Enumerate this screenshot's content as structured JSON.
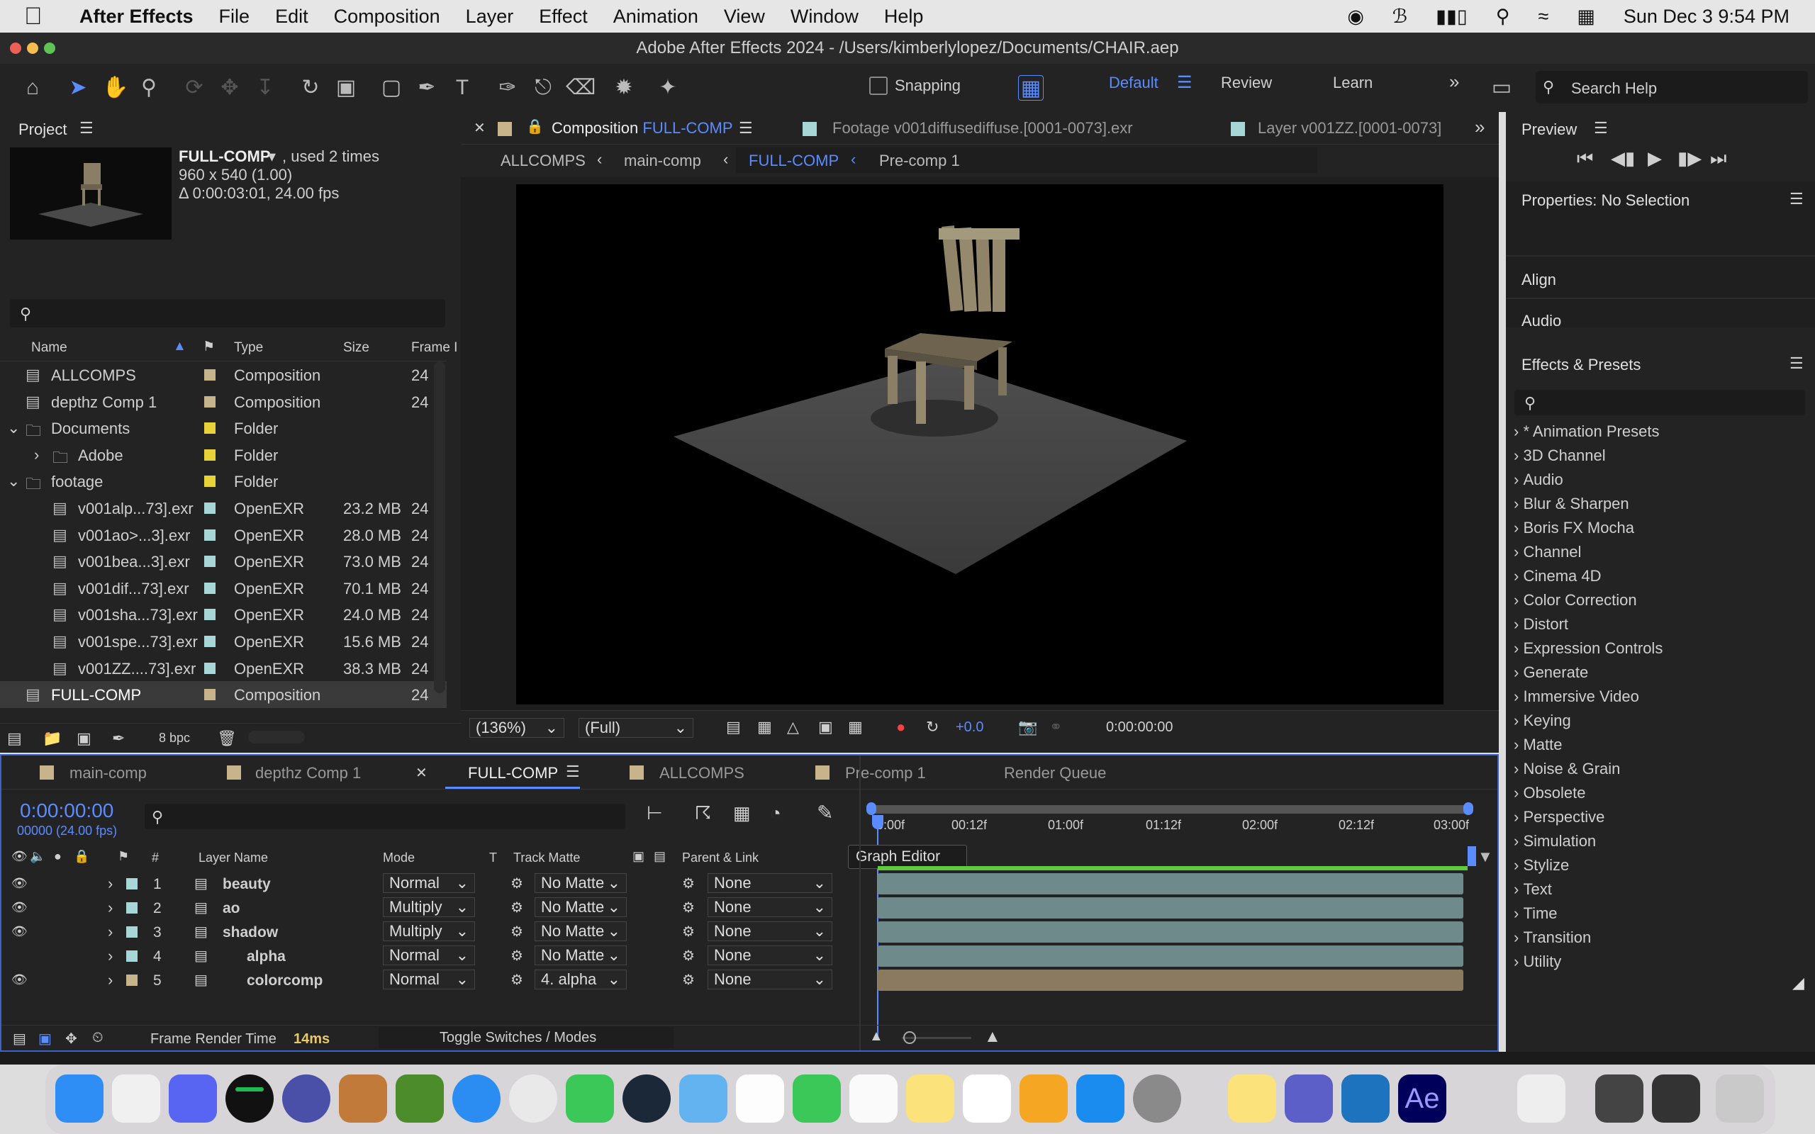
{
  "menubar": {
    "app": "After Effects",
    "items": [
      "File",
      "Edit",
      "Composition",
      "Layer",
      "Effect",
      "Animation",
      "View",
      "Window",
      "Help"
    ],
    "clock": "Sun Dec 3  9:54 PM"
  },
  "window_title": "Adobe After Effects 2024 - /Users/kimberlylopez/Documents/CHAIR.aep",
  "toolbar": {
    "snapping": "Snapping",
    "workspaces": [
      "Default",
      "Review",
      "Learn"
    ],
    "search_placeholder": "Search Help"
  },
  "project": {
    "title": "Project",
    "comp_name": "FULL-COMP",
    "used": ", used 2 times",
    "dims": "960 x 540 (1.00)",
    "duration": "Δ 0:00:03:01, 24.00 fps",
    "columns": [
      "Name",
      "Type",
      "Size",
      "Frame I"
    ],
    "items": [
      {
        "name": "ALLCOMPS",
        "type": "Composition",
        "size": "",
        "fr": "24",
        "color": "#c8b48a"
      },
      {
        "name": "depthz Comp 1",
        "type": "Composition",
        "size": "",
        "fr": "24",
        "color": "#c8b48a"
      },
      {
        "name": "Documents",
        "type": "Folder",
        "size": "",
        "fr": "",
        "color": "#e8d23a"
      },
      {
        "name": "Adobe",
        "type": "Folder",
        "size": "",
        "fr": "",
        "color": "#e8d23a"
      },
      {
        "name": "footage",
        "type": "Folder",
        "size": "",
        "fr": "",
        "color": "#e8d23a"
      },
      {
        "name": "v001alp...73].exr",
        "type": "OpenEXR",
        "size": "23.2 MB",
        "fr": "24",
        "color": "#a7d6d6"
      },
      {
        "name": "v001ao>...3].exr",
        "type": "OpenEXR",
        "size": "28.0 MB",
        "fr": "24",
        "color": "#a7d6d6"
      },
      {
        "name": "v001bea...3].exr",
        "type": "OpenEXR",
        "size": "73.0 MB",
        "fr": "24",
        "color": "#a7d6d6"
      },
      {
        "name": "v001dif...73].exr",
        "type": "OpenEXR",
        "size": "70.1 MB",
        "fr": "24",
        "color": "#a7d6d6"
      },
      {
        "name": "v001sha...73].exr",
        "type": "OpenEXR",
        "size": "24.0 MB",
        "fr": "24",
        "color": "#a7d6d6"
      },
      {
        "name": "v001spe...73].exr",
        "type": "OpenEXR",
        "size": "15.6 MB",
        "fr": "24",
        "color": "#a7d6d6"
      },
      {
        "name": "v001ZZ....73].exr",
        "type": "OpenEXR",
        "size": "38.3 MB",
        "fr": "24",
        "color": "#a7d6d6"
      },
      {
        "name": "FULL-COMP",
        "type": "Composition",
        "size": "",
        "fr": "24",
        "color": "#c8b48a"
      }
    ],
    "bpc": "8 bpc"
  },
  "viewer": {
    "tabs": [
      {
        "prefix": "Composition ",
        "name": "FULL-COMP"
      },
      {
        "prefix": "Footage ",
        "name": "v001diffusediffuse.[0001-0073].exr"
      },
      {
        "prefix": "Layer ",
        "name": "v001ZZ.[0001-0073]"
      }
    ],
    "breadcrumbs": [
      "ALLCOMPS",
      "main-comp",
      "FULL-COMP",
      "Pre-comp 1"
    ],
    "zoom": "(136%)",
    "resolution": "(Full)",
    "exposure": "+0.0",
    "timecode": "0:00:00:00"
  },
  "right": {
    "preview": "Preview",
    "properties": "Properties: No Selection",
    "align": "Align",
    "audio": "Audio",
    "effects": "Effects & Presets",
    "categories": [
      "* Animation Presets",
      "3D Channel",
      "Audio",
      "Blur & Sharpen",
      "Boris FX Mocha",
      "Channel",
      "Cinema 4D",
      "Color Correction",
      "Distort",
      "Expression Controls",
      "Generate",
      "Immersive Video",
      "Keying",
      "Matte",
      "Noise & Grain",
      "Obsolete",
      "Perspective",
      "Simulation",
      "Stylize",
      "Text",
      "Time",
      "Transition",
      "Utility"
    ]
  },
  "timeline": {
    "tabs": [
      "main-comp",
      "depthz Comp 1",
      "FULL-COMP",
      "ALLCOMPS",
      "Pre-comp 1",
      "Render Queue"
    ],
    "timecode": "0:00:00:00",
    "frames": "00000 (24.00 fps)",
    "headers": {
      "num": "#",
      "layer": "Layer Name",
      "mode": "Mode",
      "t": "T",
      "matte": "Track Matte",
      "parent": "Parent & Link"
    },
    "ruler": [
      "0:00f",
      "00:12f",
      "01:00f",
      "01:12f",
      "02:00f",
      "02:12f",
      "03:00f"
    ],
    "tooltip": "Graph Editor",
    "layers": [
      {
        "num": "1",
        "name": "beauty",
        "mode": "Normal",
        "matte": "No Matte",
        "parent": "None",
        "color": "#a7d6d6",
        "bar": "#6f8a8a"
      },
      {
        "num": "2",
        "name": "ao",
        "mode": "Multiply",
        "matte": "No Matte",
        "parent": "None",
        "color": "#a7d6d6",
        "bar": "#6f8a8a"
      },
      {
        "num": "3",
        "name": "shadow",
        "mode": "Multiply",
        "matte": "No Matte",
        "parent": "None",
        "color": "#a7d6d6",
        "bar": "#6f8a8a"
      },
      {
        "num": "4",
        "name": "alpha",
        "mode": "Normal",
        "matte": "No Matte",
        "parent": "None",
        "color": "#a7d6d6",
        "bar": "#6f8a8a"
      },
      {
        "num": "5",
        "name": "colorcomp",
        "mode": "Normal",
        "matte": "4. alpha",
        "parent": "None",
        "color": "#c8b48a",
        "bar": "#8a7a60"
      }
    ],
    "render_time_label": "Frame Render Time",
    "render_time": "14ms",
    "toggle": "Toggle Switches / Modes"
  }
}
